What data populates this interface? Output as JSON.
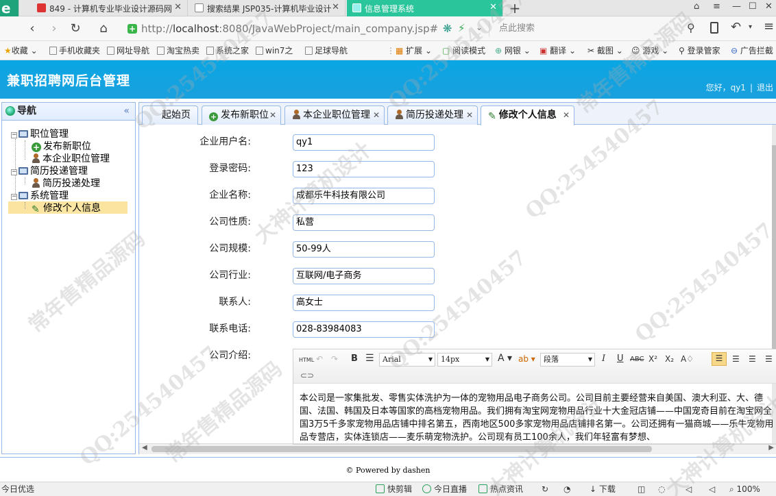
{
  "browser": {
    "tabs": [
      {
        "label": "849 - 计算机专业毕业设计源码网",
        "active": false
      },
      {
        "label": "搜索结果 JSP035-计算机毕业设计",
        "active": false
      },
      {
        "label": "信息管理系统",
        "active": true
      }
    ],
    "url_prefix": "http://",
    "url_host": "localhost",
    "url_rest": ":8080/JavaWebProject/main_company.jsp#",
    "search_placeholder": "点此搜索",
    "bookmarks": [
      "收藏",
      "手机收藏夹",
      "网址导航",
      "淘宝热卖",
      "系统之家",
      "win7之",
      "足球导航",
      "扩展",
      "阅读模式",
      "网银",
      "翻译",
      "截图",
      "游戏",
      "登录管家",
      "广告拦截"
    ]
  },
  "header": {
    "title": "兼职招聘网后台管理",
    "greeting": "您好，",
    "username": "qy1",
    "separator": "|",
    "logout": "退出"
  },
  "nav": {
    "title": "导航",
    "collapse_glyph": "«",
    "groups": [
      {
        "label": "职位管理",
        "items": [
          "发布新职位",
          "本企业职位管理"
        ]
      },
      {
        "label": "简历投递管理",
        "items": [
          "简历投递处理"
        ]
      },
      {
        "label": "系统管理",
        "items": [
          "修改个人信息"
        ]
      }
    ],
    "selected": "修改个人信息"
  },
  "tabs": [
    {
      "label": "起始页",
      "closable": false,
      "icon": ""
    },
    {
      "label": "发布新职位",
      "closable": true,
      "icon": "plus"
    },
    {
      "label": "本企业职位管理",
      "closable": true,
      "icon": "person"
    },
    {
      "label": "简历投递处理",
      "closable": true,
      "icon": "person"
    },
    {
      "label": "修改个人信息",
      "closable": true,
      "icon": "pencil",
      "active": true
    }
  ],
  "form": {
    "fields": [
      {
        "label": "企业用户名:",
        "value": "qy1"
      },
      {
        "label": "登录密码:",
        "value": "123"
      },
      {
        "label": "企业名称:",
        "value": "成都乐牛科技有限公司"
      },
      {
        "label": "公司性质:",
        "value": "私营"
      },
      {
        "label": "公司规模:",
        "value": "50-99人"
      },
      {
        "label": "公司行业:",
        "value": "互联网/电子商务"
      },
      {
        "label": "联系人:",
        "value": "高女士"
      },
      {
        "label": "联系电话:",
        "value": "028-83984083"
      }
    ],
    "intro_label": "公司介绍:"
  },
  "editor": {
    "html_label": "HTML",
    "font_family": "Arial",
    "font_size": "14px",
    "paragraph": "段落",
    "content": "本公司是一家集批发、零售实体洗护为一体的宠物用品电子商务公司。公司目前主要经营来自美国、澳大利亚、大、德国、法国、韩国及日本等国家的高档宠物用品。我们拥有淘宝网宠物用品行业十大金冠店铺——中国宠奇目前在淘宝网全国3万5千多家宠物用品店铺中排名第五，西南地区500多家宠物用品店铺排名第一。公司还拥有一猫商城——乐牛宠物用品专营店，实体连锁店——麦乐萌宠物洗护。公司现有员工100余人，我们年轻富有梦想、"
  },
  "footer": {
    "text": "Powered by dashen",
    "symbol": "©"
  },
  "statusbar": {
    "left": "今日优选",
    "items": [
      "快剪辑",
      "今日直播",
      "热点资讯",
      "下载",
      "100%"
    ]
  },
  "watermark": {
    "lines": [
      "常年售精品源码",
      "QQ:254540457",
      "大神计算机设计"
    ]
  },
  "colors": {
    "header_bg": "#0aa6e4",
    "active_tab": "#2bc59b",
    "panel_border": "#95b8e7",
    "selected_node": "#fbe4a0"
  }
}
